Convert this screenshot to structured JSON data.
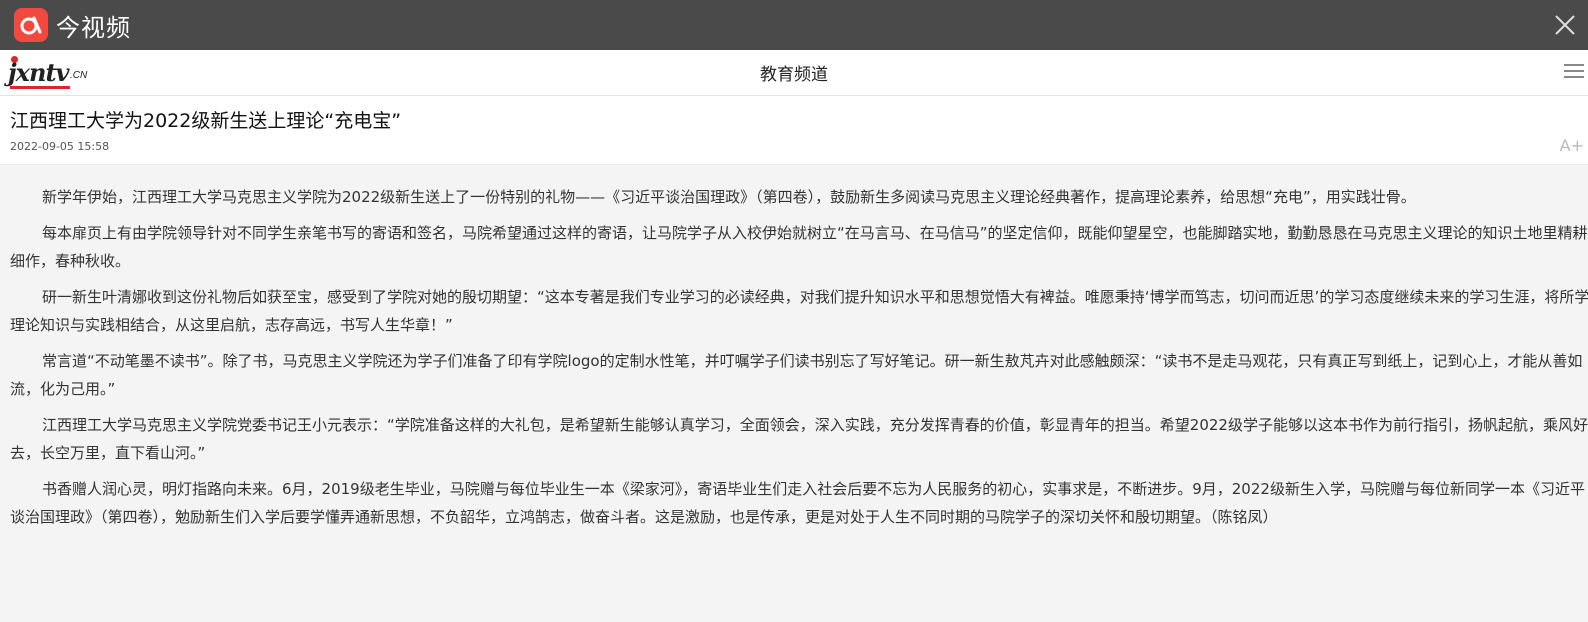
{
  "app": {
    "title": "今视频"
  },
  "header": {
    "logo_text": "jxntv",
    "logo_cn": ".CN",
    "channel": "教育频道"
  },
  "article": {
    "title": "江西理工大学为2022级新生送上理论“充电宝”",
    "date": "2022-09-05 15:58",
    "font_size_label": "A+",
    "paragraphs": [
      "新学年伊始，江西理工大学马克思主义学院为2022级新生送上了一份特别的礼物——《习近平谈治国理政》（第四卷），鼓励新生多阅读马克思主义理论经典著作，提高理论素养，给思想“充电”，用实践壮骨。",
      "每本扉页上有由学院领导针对不同学生亲笔书写的寄语和签名，马院希望通过这样的寄语，让马院学子从入校伊始就树立“在马言马、在马信马”的坚定信仰，既能仰望星空，也能脚踏实地，勤勤恳恳在马克思主义理论的知识土地里精耕细作，春种秋收。",
      "研一新生叶清娜收到这份礼物后如获至宝，感受到了学院对她的殷切期望：“这本专著是我们专业学习的必读经典，对我们提升知识水平和思想觉悟大有裨益。唯愿秉持‘博学而笃志，切问而近思’的学习态度继续未来的学习生涯，将所学理论知识与实践相结合，从这里启航，志存高远，书写人生华章！”",
      "常言道“不动笔墨不读书”。除了书，马克思主义学院还为学子们准备了印有学院logo的定制水性笔，并叮嘱学子们读书别忘了写好笔记。研一新生敖芃卉对此感触颇深：“读书不是走马观花，只有真正写到纸上，记到心上，才能从善如流，化为己用。”",
      "江西理工大学马克思主义学院党委书记王小元表示：“学院准备这样的大礼包，是希望新生能够认真学习，全面领会，深入实践，充分发挥青春的价值，彰显青年的担当。希望2022级学子能够以这本书作为前行指引，扬帆起航，乘风好去，长空万里，直下看山河。”",
      "书香赠人润心灵，明灯指路向未来。6月，2019级老生毕业，马院赠与每位毕业生一本《梁家河》，寄语毕业生们走入社会后要不忘为人民服务的初心，实事求是，不断进步。9月，2022级新生入学，马院赠与每位新同学一本《习近平谈治国理政》（第四卷），勉励新生们入学后要学懂弄通新思想，不负韶华，立鸿鹄志，做奋斗者。这是激励，也是传承，更是对处于人生不同时期的马院学子的深切关怀和殷切期望。（陈铭凤）"
    ]
  },
  "colors": {
    "titlebar": "#4a4a4a",
    "brand": "#f2493f",
    "logo_red": "#d8282a"
  },
  "icons": {
    "app": "app-logo-icon",
    "close": "close-icon",
    "menu": "menu-icon"
  }
}
